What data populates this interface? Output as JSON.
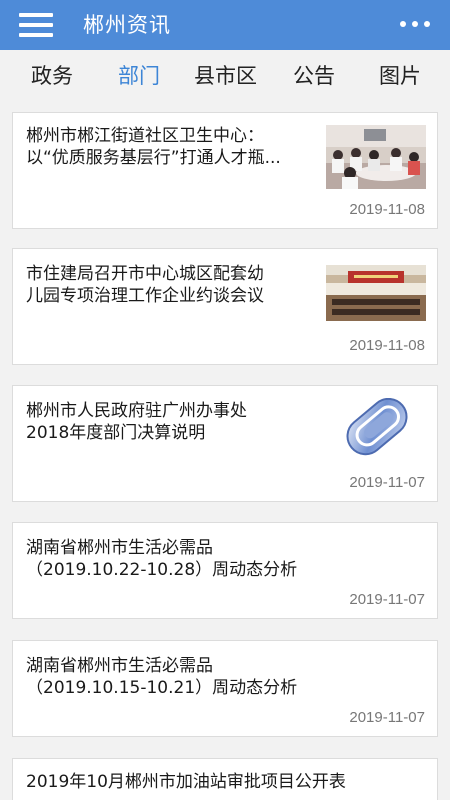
{
  "header": {
    "title": "郴州资讯"
  },
  "tabs": [
    {
      "label": "政务",
      "active": false
    },
    {
      "label": "部门",
      "active": true
    },
    {
      "label": "县市区",
      "active": false
    },
    {
      "label": "公告",
      "active": false
    },
    {
      "label": "图片",
      "active": false
    }
  ],
  "articles": [
    {
      "title_line1": "郴州市郴江街道社区卫生中心：",
      "title_line2": "以“优质服务基层行”打通人才瓶...",
      "date": "2019-11-08",
      "thumb": "meeting-photo"
    },
    {
      "title_line1": "市住建局召开市中心城区配套幼",
      "title_line2": "儿园专项治理工作企业约谈会议",
      "date": "2019-11-08",
      "thumb": "conference-photo"
    },
    {
      "title_line1": "郴州市人民政府驻广州办事处",
      "title_line2": "2018年度部门决算说明",
      "date": "2019-11-07",
      "thumb": "attachment-icon"
    },
    {
      "title_line1": "湖南省郴州市生活必需品",
      "title_line2": "（2019.10.22-10.28）周动态分析",
      "date": "2019-11-07"
    },
    {
      "title_line1": "湖南省郴州市生活必需品",
      "title_line2": "（2019.10.15-10.21）周动态分析",
      "date": "2019-11-07"
    },
    {
      "title_line1": "2019年10月郴州市加油站审批项目公开表"
    }
  ],
  "colors": {
    "header_bg": "#4e8bd8",
    "tab_active": "#3d85d6"
  }
}
